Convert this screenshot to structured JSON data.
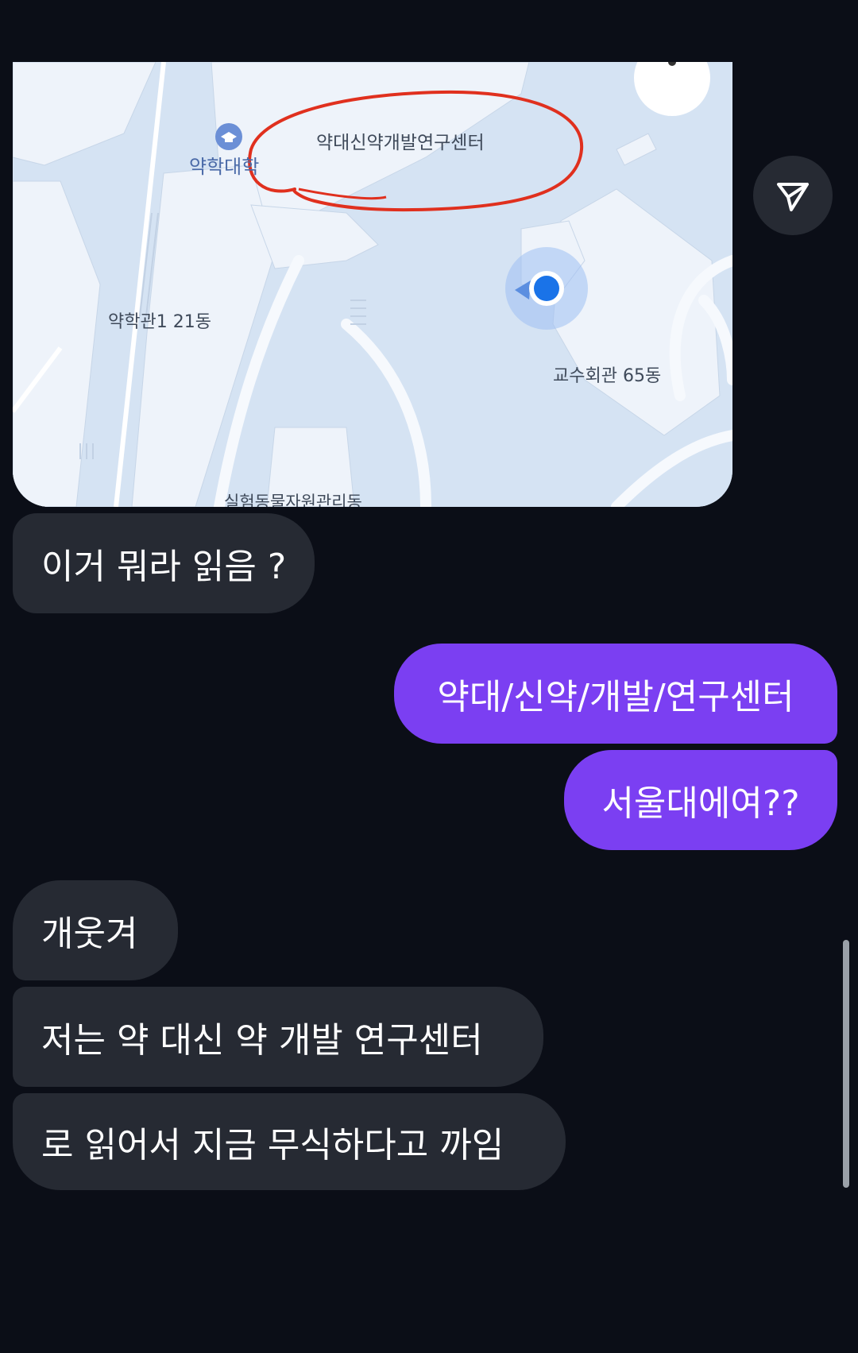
{
  "map": {
    "labels": {
      "building_highlighted": "약대신약개발연구센터",
      "pharmacy_college": "약학대학",
      "pharmacy_hall": "약학관1 21동",
      "faculty_club": "교수회관 65동",
      "bottom_cut": "실험동물자원관리동"
    }
  },
  "messages": [
    {
      "direction": "incoming",
      "text": "이거 뭐라 읽음 ?"
    },
    {
      "direction": "outgoing",
      "text": "약대/신약/개발/연구센터"
    },
    {
      "direction": "outgoing",
      "text": "서울대에여??"
    },
    {
      "direction": "incoming",
      "text": "개웃겨"
    },
    {
      "direction": "incoming",
      "text": "저는 약 대신 약 개발 연구센터"
    },
    {
      "direction": "incoming",
      "text": "로 읽어서 지금 무식하다고 까임"
    }
  ],
  "icons": {
    "share": "send-icon",
    "pharmacy_marker": "graduation-cap-icon",
    "location": "location-dot-icon"
  },
  "colors": {
    "background": "#0b0e17",
    "incoming_bubble": "#262a33",
    "outgoing_bubble": "#7b3ff2",
    "circle_annotation": "#e0301e",
    "location_dot": "#1a73e8"
  }
}
